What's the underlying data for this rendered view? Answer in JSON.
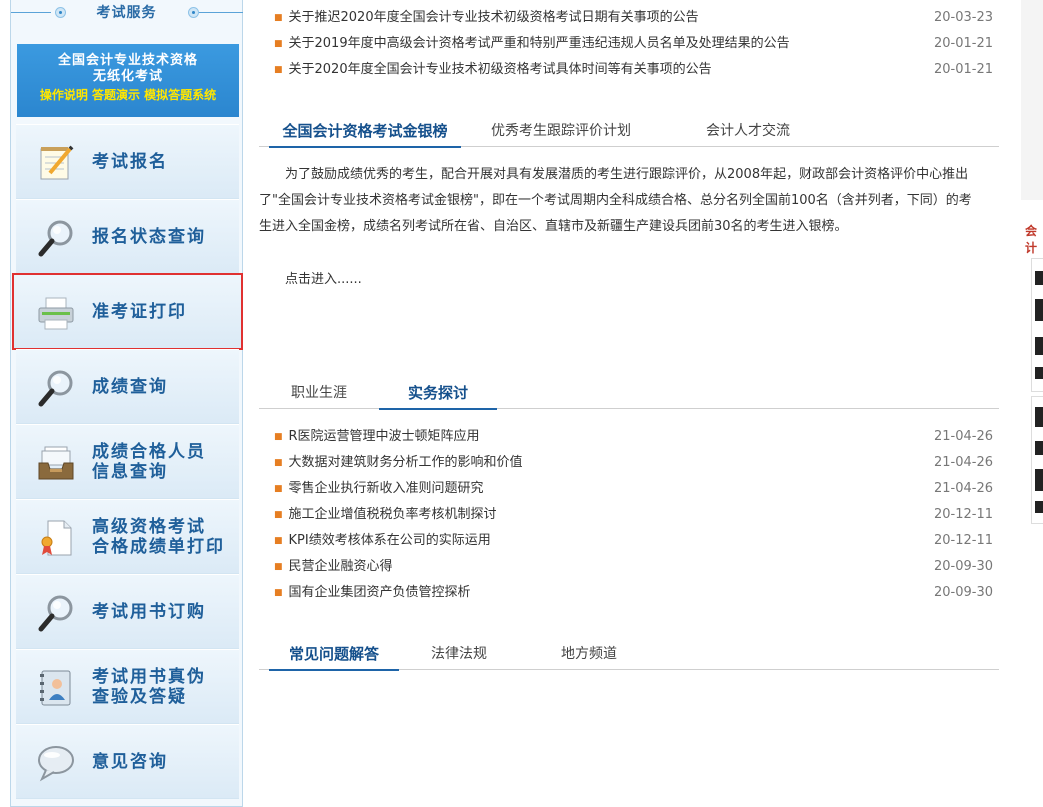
{
  "sidebar": {
    "title": "考试服务",
    "banner": {
      "line1": "全国会计专业技术资格",
      "line2": "无纸化考试",
      "line3": "操作说明 答题演示 模拟答题系统"
    },
    "items": [
      {
        "label": "考试报名",
        "icon": "notepad-pencil-icon"
      },
      {
        "label": "报名状态查询",
        "icon": "magnifier-icon"
      },
      {
        "label": "准考证打印",
        "icon": "printer-icon"
      },
      {
        "label": "成绩查询",
        "icon": "magnifier-icon"
      },
      {
        "label": "成绩合格人员信息查询",
        "label1": "成绩合格人员",
        "label2": "信息查询",
        "icon": "inbox-tray-icon"
      },
      {
        "label": "高级资格考试合格成绩单打印",
        "label1": "高级资格考试",
        "label2": "合格成绩单打印",
        "icon": "certificate-ribbon-icon"
      },
      {
        "label": "考试用书订购",
        "icon": "magnifier-icon"
      },
      {
        "label": "考试用书真伪查验及答疑",
        "label1": "考试用书真伪",
        "label2": "查验及答疑",
        "icon": "id-card-icon"
      },
      {
        "label": "意见咨询",
        "icon": "speech-bubble-icon"
      }
    ]
  },
  "announcements": [
    {
      "title": "关于推迟2020年度全国会计专业技术初级资格考试日期有关事项的公告",
      "date": "20-03-23"
    },
    {
      "title": "关于2019年度中高级会计资格考试严重和特别严重违纪违规人员名单及处理结果的公告",
      "date": "20-01-21"
    },
    {
      "title": "关于2020年度全国会计专业技术初级资格考试具体时间等有关事项的公告",
      "date": "20-01-21"
    }
  ],
  "section1": {
    "tabs": [
      "全国会计资格考试金银榜",
      "优秀考生跟踪评价计划",
      "会计人才交流"
    ],
    "intro": "为了鼓励成绩优秀的考生，配合开展对具有发展潜质的考生进行跟踪评价，从2008年起，财政部会计资格评价中心推出了\"全国会计专业技术资格考试金银榜\"，即在一个考试周期内全科成绩合格、总分名列全国前100名（含并列者，下同）的考生进入全国金榜，成绩名列考试所在省、自治区、直辖市及新疆生产建设兵团前30名的考生进入银榜。",
    "more": "点击进入......"
  },
  "section2": {
    "tabs": [
      "职业生涯",
      "实务探讨"
    ],
    "items": [
      {
        "title": "R医院运营管理中波士顿矩阵应用",
        "date": "21-04-26"
      },
      {
        "title": "大数据对建筑财务分析工作的影响和价值",
        "date": "21-04-26"
      },
      {
        "title": "零售企业执行新收入准则问题研究",
        "date": "21-04-26"
      },
      {
        "title": "施工企业增值税税负率考核机制探讨",
        "date": "20-12-11"
      },
      {
        "title": "KPI绩效考核体系在公司的实际运用",
        "date": "20-12-11"
      },
      {
        "title": "民营企业融资心得",
        "date": "20-09-30"
      },
      {
        "title": "国有企业集团资产负债管控探析",
        "date": "20-09-30"
      }
    ]
  },
  "section3": {
    "tabs": [
      "常见问题解答",
      "法律法规",
      "地方频道"
    ]
  },
  "right_fragment": {
    "text": "会计"
  },
  "colors": {
    "accent": "#1e64a8",
    "bullet": "#e67e22",
    "highlight": "#e03131",
    "banner_yellow": "#ffe600"
  }
}
